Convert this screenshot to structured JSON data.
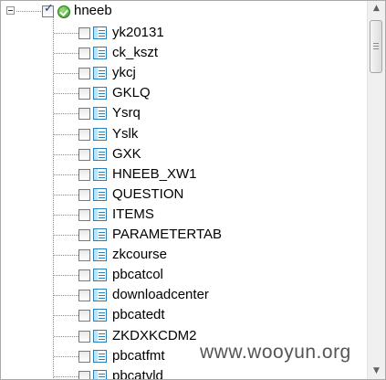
{
  "tree": {
    "root": {
      "label": "hneeb",
      "expander_icon": "collapse-icon",
      "checked": true,
      "status_icon": "ok-icon"
    },
    "children": [
      {
        "label": "yk20131"
      },
      {
        "label": "ck_kszt"
      },
      {
        "label": "ykcj"
      },
      {
        "label": "GKLQ"
      },
      {
        "label": "Ysrq"
      },
      {
        "label": "Yslk"
      },
      {
        "label": "GXK"
      },
      {
        "label": "HNEEB_XW1"
      },
      {
        "label": "QUESTION"
      },
      {
        "label": "ITEMS"
      },
      {
        "label": "PARAMETERTAB"
      },
      {
        "label": "zkcourse"
      },
      {
        "label": "pbcatcol"
      },
      {
        "label": "downloadcenter"
      },
      {
        "label": "pbcatedt"
      },
      {
        "label": "ZKDXKCDM2"
      },
      {
        "label": "pbcatfmt"
      },
      {
        "label": "pbcatvld"
      }
    ],
    "child_icon": "table-icon"
  },
  "scrollbar": {
    "up_icon": "scroll-up-arrow-icon",
    "down_icon": "scroll-down-arrow-icon"
  },
  "watermark": {
    "text": "www.wooyun.org"
  }
}
